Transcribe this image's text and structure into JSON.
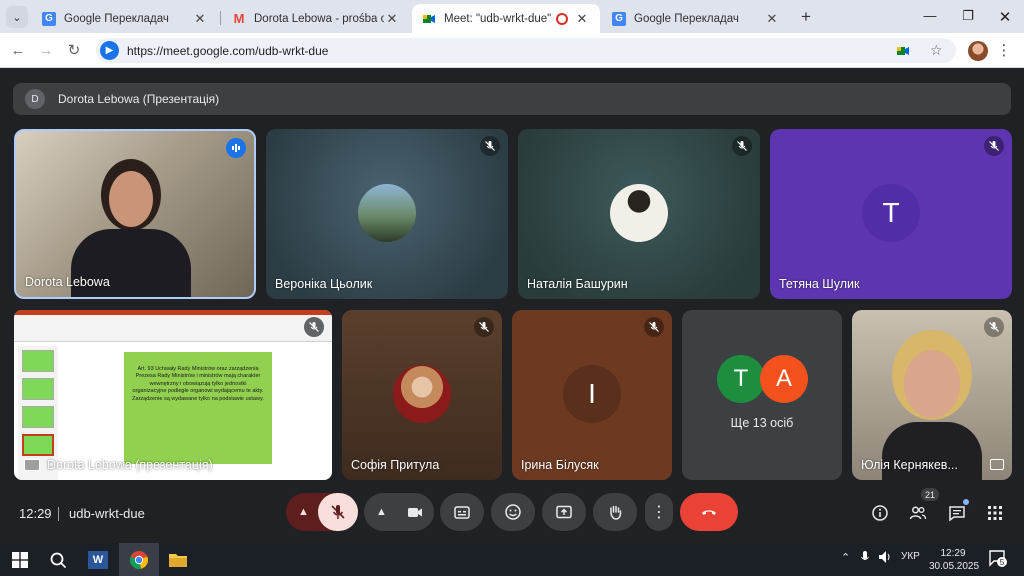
{
  "browser": {
    "tabs": [
      {
        "title": "Google Перекладач",
        "icon": "translate-icon"
      },
      {
        "title": "Dorota Lebowa - prośba o moż",
        "icon": "gmail-icon"
      },
      {
        "title": "Meet: \"udb-wrkt-due\"",
        "icon": "meet-icon"
      },
      {
        "title": "Google Перекладач",
        "icon": "translate-icon"
      }
    ],
    "url": "https://meet.google.com/udb-wrkt-due"
  },
  "meet": {
    "presenter_banner": {
      "avatar_letter": "D",
      "text": "Dorota Lebowa (Презентація)"
    },
    "tiles": [
      {
        "name": "Dorota Lebowa"
      },
      {
        "name": "Вероніка Цьолик"
      },
      {
        "name": "Наталія Башурин"
      },
      {
        "name": "Тетяна Шулик",
        "letter": "T"
      },
      {
        "name": "Dorota Lebowa (презентація)"
      },
      {
        "name": "Софія Притула"
      },
      {
        "name": "Ірина Білусяк",
        "letter": "I"
      },
      {
        "name": "Ще 13 осіб",
        "letters": [
          "T",
          "A"
        ]
      },
      {
        "name": "Юлія Кернякев..."
      }
    ],
    "slide_text": "Art. 93 Uchwały Rady Ministrów oraz zarządzenia Prezesa Rady Ministrów i ministrów mają charakter wewnętrzny i obowiązują tylko jednostki organizacyjne podległe organowi wydającemu te akty. Zarządzenie są wydawane tylko na podstawie ustawy.",
    "time": "12:29",
    "meeting_code": "udb-wrkt-due",
    "participants_count": "21"
  },
  "taskbar": {
    "language": "УКР",
    "time": "12:29",
    "date": "30.05.2025",
    "notifications": "5"
  },
  "colors": {
    "accent": "#1a73e8",
    "end_call": "#ea4335",
    "mic_off": "#f9dedc"
  }
}
